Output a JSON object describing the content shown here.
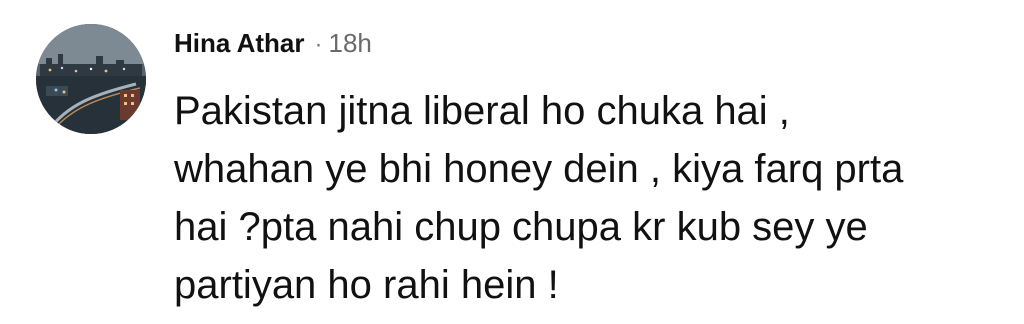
{
  "comment": {
    "author": "Hina Athar",
    "separator": "·",
    "time": "18h",
    "avatar_icon": "profile-photo-night-city",
    "text_lines": [
      "Pakistan jitna liberal ho chuka hai ,",
      "whahan ye bhi honey dein , kiya farq prta",
      "hai ?pta nahi chup chupa kr kub sey ye",
      "partiyan ho rahi hein !"
    ]
  }
}
